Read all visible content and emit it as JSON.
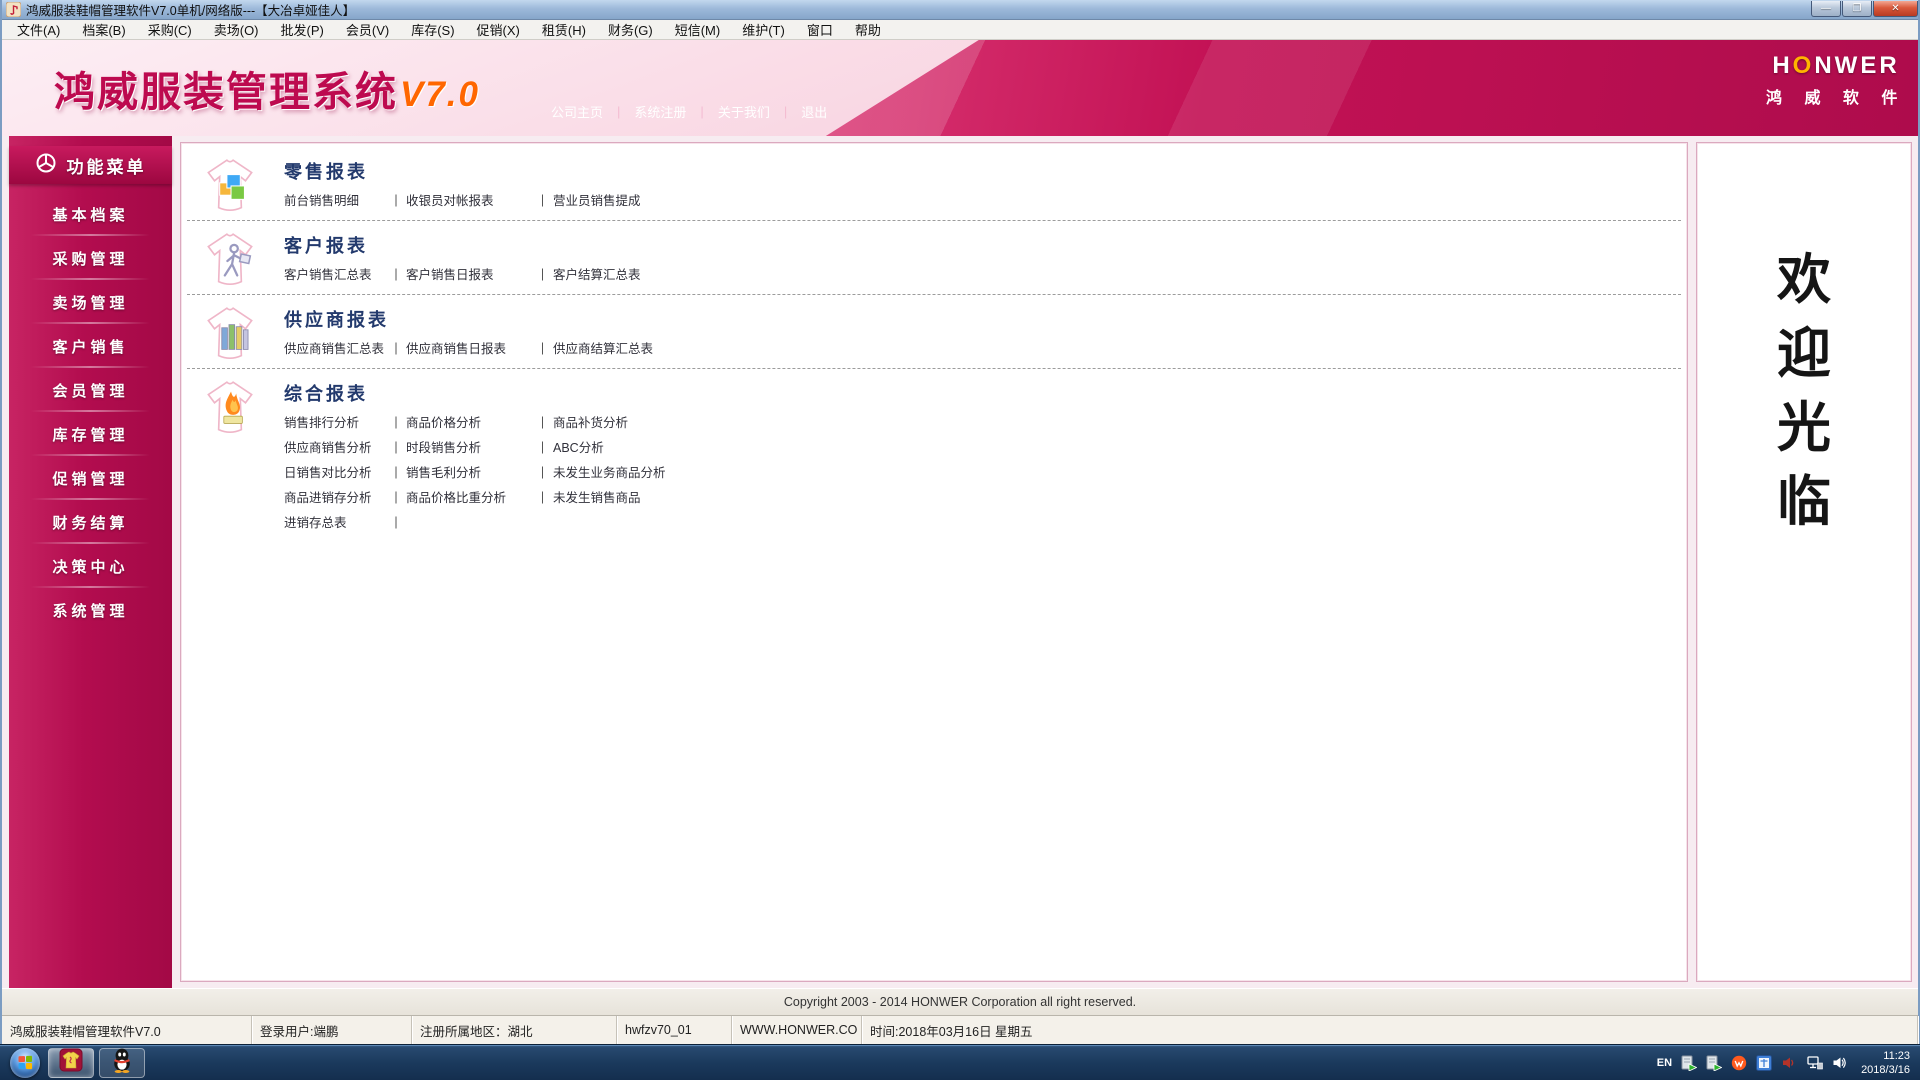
{
  "window": {
    "title": "鸿威服装鞋帽管理软件V7.0单机/网络版---【大冶卓娅佳人】",
    "controls": {
      "minimize": "—",
      "maximize": "❐",
      "close": "✕"
    }
  },
  "menubar": [
    "文件(A)",
    "档案(B)",
    "采购(C)",
    "卖场(O)",
    "批发(P)",
    "会员(V)",
    "库存(S)",
    "促销(X)",
    "租赁(H)",
    "财务(G)",
    "短信(M)",
    "维护(T)",
    "窗口",
    "帮助"
  ],
  "banner": {
    "title": "鸿威服装管理系统",
    "version": "V7.0",
    "nav": [
      "公司主页",
      "系统注册",
      "关于我们",
      "退出"
    ],
    "logo": "HONWER",
    "logo_sub": "鸿 威 软 件"
  },
  "sidebar": {
    "header": "功能菜单",
    "items": [
      "基本档案",
      "采购管理",
      "卖场管理",
      "客户销售",
      "会员管理",
      "库存管理",
      "促销管理",
      "财务结算",
      "决策中心",
      "系统管理"
    ]
  },
  "report_sections": [
    {
      "title": "零售报表",
      "icon": "retail-cubes-icon",
      "rows": [
        [
          "前台销售明细",
          "收银员对帐报表",
          "营业员销售提成"
        ]
      ]
    },
    {
      "title": "客户报表",
      "icon": "customer-figure-icon",
      "rows": [
        [
          "客户销售汇总表",
          "客户销售日报表",
          "客户结算汇总表"
        ]
      ]
    },
    {
      "title": "供应商报表",
      "icon": "supplier-books-icon",
      "rows": [
        [
          "供应商销售汇总表",
          "供应商销售日报表",
          "供应商结算汇总表"
        ]
      ]
    },
    {
      "title": "综合报表",
      "icon": "analysis-flame-icon",
      "rows": [
        [
          "销售排行分析",
          "商品价格分析",
          "商品补货分析"
        ],
        [
          "供应商销售分析",
          "时段销售分析",
          "ABC分析"
        ],
        [
          "日销售对比分析",
          "销售毛利分析",
          "未发生业务商品分析"
        ],
        [
          "商品进销存分析",
          "商品价格比重分析",
          "未发生销售商品"
        ],
        [
          "进销存总表"
        ]
      ]
    }
  ],
  "welcome": {
    "chars": [
      "欢",
      "迎",
      "光",
      "临"
    ]
  },
  "copyright": "Copyright 2003 - 2014 HONWER Corporation all right reserved.",
  "statusbar": [
    "鸿威服装鞋帽管理软件V7.0",
    "登录用户:端鹏",
    "注册所属地区：湖北",
    "hwfzv70_01",
    "WWW.HONWER.CO",
    "时间:2018年03月16日  星期五"
  ],
  "taskbar": {
    "tray_lang": "EN",
    "clock_time": "11:23",
    "clock_date": "2018/3/16"
  },
  "colors": {
    "crimson": "#b30d4f",
    "banner_deep": "#c31255",
    "title_navy": "#233a6d",
    "version_orange": "#ff6600",
    "logo_orange": "#ffb300"
  }
}
